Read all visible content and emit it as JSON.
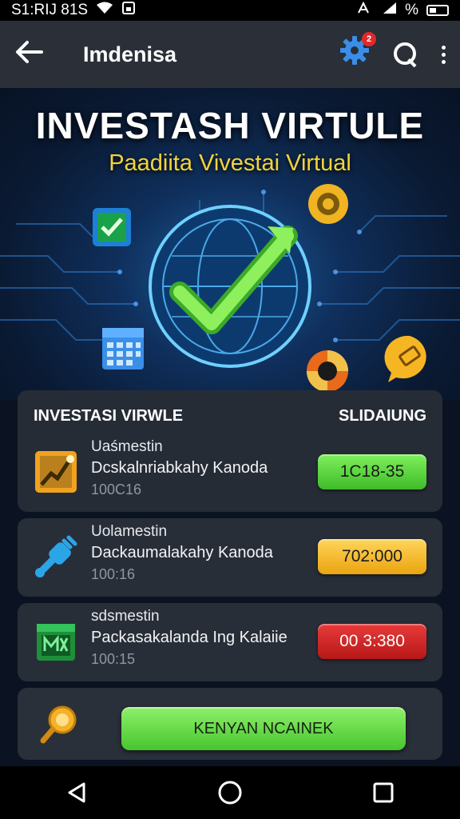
{
  "status_bar": {
    "left_text": "S1:RIJ 81S",
    "right_text": "%"
  },
  "appbar": {
    "title": "Imdenisa",
    "notification_count": "2"
  },
  "hero": {
    "title": "INVESTASH VIRTULE",
    "subtitle": "Paadiita Vivestai Virtual"
  },
  "panel": {
    "left_heading": "INVESTASI VIRWLE",
    "right_heading": "SLIDAIUNG"
  },
  "rows": [
    {
      "label": "Uaśmestin",
      "name": "Dcskalnriabkahy Kanoda",
      "sub": "100C16",
      "value": "1C18-35",
      "value_color": "#4fcf36",
      "icon": "chart-up-icon"
    },
    {
      "label": "Uolamestin",
      "name": "Dackaumalakahy Kanoda",
      "sub": "100:16",
      "value": "702:000",
      "value_color": "#f2b12a",
      "icon": "plug-icon"
    },
    {
      "label": "sdsmestin",
      "name": "Packasakalanda Ing Kalaiie",
      "sub": "100:15",
      "value": "00 3:380",
      "value_color": "#d42626",
      "icon": "calendar-icon"
    }
  ],
  "cta": {
    "label": "KENYAN NCAINEK"
  },
  "colors": {
    "accent_green": "#57d23a",
    "accent_yellow": "#f2b12a",
    "accent_red": "#d42626",
    "appbar_bg": "#2a2f38",
    "card_bg": "#282e38"
  }
}
